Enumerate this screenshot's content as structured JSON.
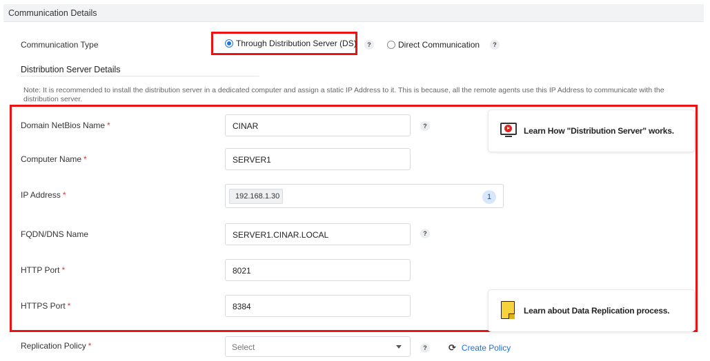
{
  "section": {
    "title": "Communication Details"
  },
  "communication": {
    "label": "Communication Type",
    "options": [
      {
        "label": "Through Distribution Server (DS)",
        "selected": true
      },
      {
        "label": "Direct Communication",
        "selected": false
      }
    ]
  },
  "ds_details": {
    "heading": "Distribution Server Details",
    "note": "Note: It is recommended to install the distribution server in a dedicated computer and assign a static IP Address to it. This is because, all the remote agents use this IP Address to communicate with the distribution server."
  },
  "fields": {
    "domain": {
      "label": "Domain NetBios Name",
      "value": "CINAR",
      "required": "*"
    },
    "computer": {
      "label": "Computer Name",
      "value": "SERVER1",
      "required": "*"
    },
    "ip": {
      "label": "IP Address",
      "value": "192.168.1.30",
      "count": "1",
      "required": "*"
    },
    "fqdn": {
      "label": "FQDN/DNS Name",
      "value": "SERVER1.CINAR.LOCAL"
    },
    "http": {
      "label": "HTTP Port",
      "value": "8021",
      "required": "*"
    },
    "https": {
      "label": "HTTPS Port",
      "value": "8384",
      "required": "*"
    },
    "replication": {
      "label": "Replication Policy",
      "placeholder": "Select",
      "required": "*"
    }
  },
  "help_glyph": "?",
  "refresh_glyph": "⟳",
  "create_policy": "Create Policy",
  "learn_cards": {
    "ds": "Learn How \"Distribution Server\" works.",
    "replication": "Learn about Data Replication process."
  },
  "colors": {
    "accent": "#1a73e8",
    "highlight": "#ee1111",
    "link": "#1a6fd6"
  },
  "icons": {
    "video": "tv-play-icon",
    "note": "sticky-note-icon",
    "refresh": "refresh-icon"
  }
}
